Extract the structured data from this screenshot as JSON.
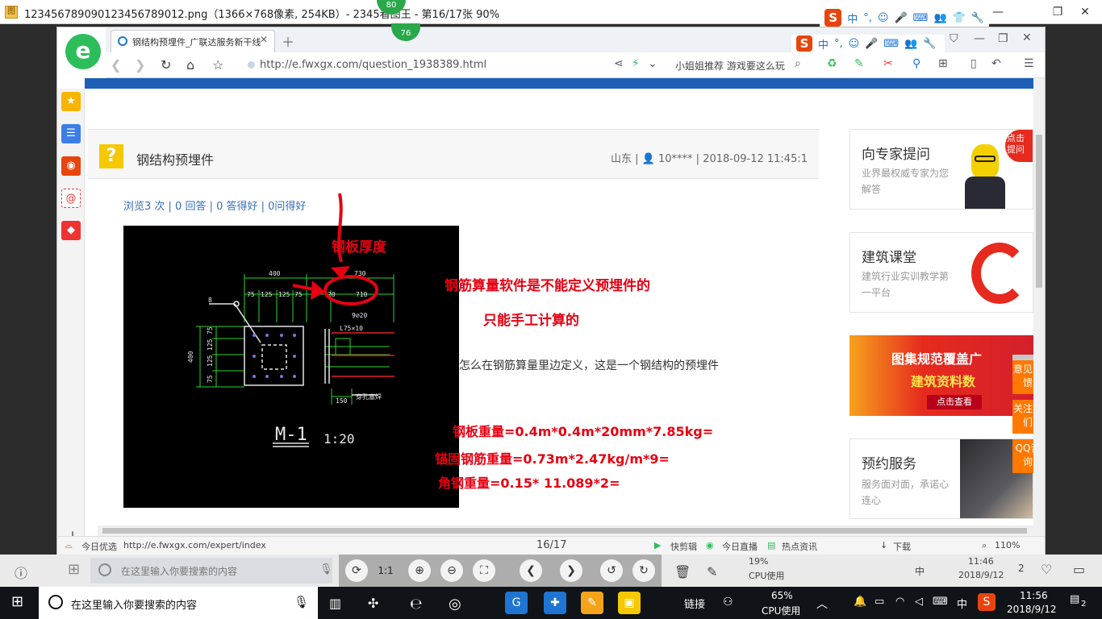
{
  "viewer": {
    "title": "12345678909012345678901​2.png（1366×768像素, 254KB）- 2345看图王 - 第16/17张 90%",
    "minimize": "—",
    "maximize": "❐",
    "close": "✕"
  },
  "badges": {
    "top": "80",
    "second": "76"
  },
  "ime": {
    "logo": "S",
    "items": [
      "中",
      "°,",
      "☺",
      "🎤",
      "⌨",
      "👥",
      "👕",
      "🔧"
    ]
  },
  "browser": {
    "tab_title": "钢结构预埋件_广联达服务新干线",
    "address": "http://e.fwxgx.com/question_1938389.html",
    "toolbar_promo": "小姐姐推荐 游戏要这么玩",
    "status_left": "今日优选",
    "status_url": "http://e.fwxgx.com/expert/index",
    "page_counter": "16/17",
    "status_items": [
      "快剪辑",
      "今日直播",
      "热点资讯",
      "下载"
    ],
    "zoom": "110%"
  },
  "question": {
    "title": "钢结构预埋件",
    "meta": "山东 | 👤 10**** | 2018-09-12 11:45:1",
    "stats": "浏览3 次 | 0 回答 | 0 答得好 | 0问得好",
    "description": "怎么在钢筋算量里边定义，这是一个钢结构的预埋件"
  },
  "annotations": {
    "plate_thickness": "钢板厚度",
    "note1": "钢筋算量软件是不能定义预埋件的",
    "note2": "只能手工计算的",
    "plate_weight": "钢板重量=0.4m*0.4m*20mm*7.85kg=",
    "anchor_weight": "锚固钢筋重量=0.73m*2.47kg/m*9=",
    "angle_weight": "角钢重量=0.15* 11.089*2="
  },
  "cad": {
    "dims_top": [
      "400",
      "730"
    ],
    "dims_row": [
      "75",
      "125",
      "125",
      "75",
      "20",
      "710"
    ],
    "rebar": "9⌀20",
    "angle": "L75×10",
    "label_8": "8",
    "dim_side": "400",
    "dims_side": [
      "75",
      "125",
      "125",
      "75"
    ],
    "dim_bottom": "150",
    "bottom_note": "穿孔塞焊",
    "part": "M-1",
    "scale": "1:20"
  },
  "right_column": {
    "expert_title": "向专家提问",
    "expert_sub": "业界最权威专家为您解答",
    "mascot_bubble": "点击提问",
    "course_title": "建筑课堂",
    "course_sub": "建筑行业实训教学第一平台",
    "ad_line1": "图集规范覆盖广",
    "ad_line2": "建筑资料数",
    "ad_button": "点击查看",
    "service_title": "预约服务",
    "service_sub": "服务面对面，承诺心连心"
  },
  "float_buttons": [
    "意见反馈",
    "关注我们",
    "QQ咨询"
  ],
  "inner_taskbar": {
    "search_placeholder": "在这里输入你要搜索的内容",
    "scale_label": "1:1",
    "cpu_percent": "19%",
    "cpu_label": "CPU使用",
    "ime": "中",
    "time": "11:46",
    "date": "2018/9/12",
    "notif": "2"
  },
  "taskbar": {
    "search_placeholder": "在这里输入你要搜索的内容",
    "link_label": "链接",
    "cpu_percent": "65%",
    "cpu_label": "CPU使用",
    "ime": "中",
    "time": "11:56",
    "date": "2018/9/12",
    "notif": "2"
  }
}
